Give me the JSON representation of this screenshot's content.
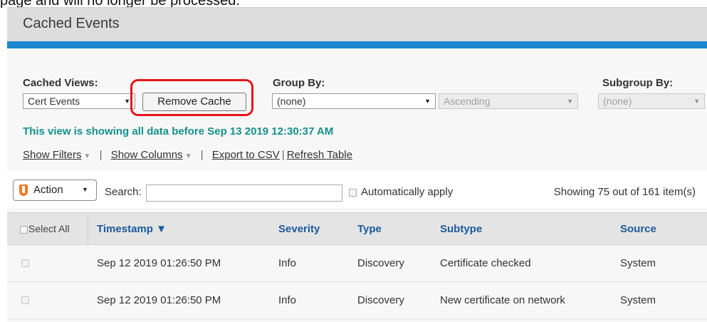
{
  "top_text": "page and will no longer be processed.",
  "panel": {
    "title": "Cached Events"
  },
  "controls": {
    "cached_views_label": "Cached Views:",
    "cached_views_value": "Cert Events",
    "remove_cache_label": "Remove Cache",
    "group_by_label": "Group By:",
    "group_by_value": "(none)",
    "sort_order_value": "Ascending",
    "subgroup_by_label": "Subgroup By:",
    "subgroup_by_value": "(none)"
  },
  "info_message": "This view is showing all data before Sep 13 2019 12:30:37 AM",
  "links": {
    "show_filters": "Show Filters",
    "show_columns": "Show Columns",
    "export_csv": "Export to CSV",
    "refresh_table": "Refresh Table"
  },
  "toolbar": {
    "action_label": "Action",
    "search_label": "Search:",
    "search_value": "",
    "auto_apply_label": "Automatically apply",
    "showing_text": "Showing 75 out of 161 item(s)"
  },
  "table": {
    "select_all_label": "Select All",
    "columns": [
      "Timestamp ▼",
      "Severity",
      "Type",
      "Subtype",
      "Source"
    ],
    "rows": [
      [
        "Sep 12 2019 01:26:50 PM",
        "Info",
        "Discovery",
        "Certificate checked",
        "System"
      ],
      [
        "Sep 12 2019 01:26:50 PM",
        "Info",
        "Discovery",
        "New certificate on network",
        "System"
      ]
    ]
  },
  "colors": {
    "accent_bar": "#1a87d0",
    "info_text": "#14908a",
    "column_header_text": "#1c5a9c",
    "highlight_outline": "#e4141b",
    "action_icon": "#f07820"
  },
  "icons": {
    "action": "shield-icon",
    "dropdown": "chevron-down-icon",
    "sort": "sort-desc-icon"
  }
}
